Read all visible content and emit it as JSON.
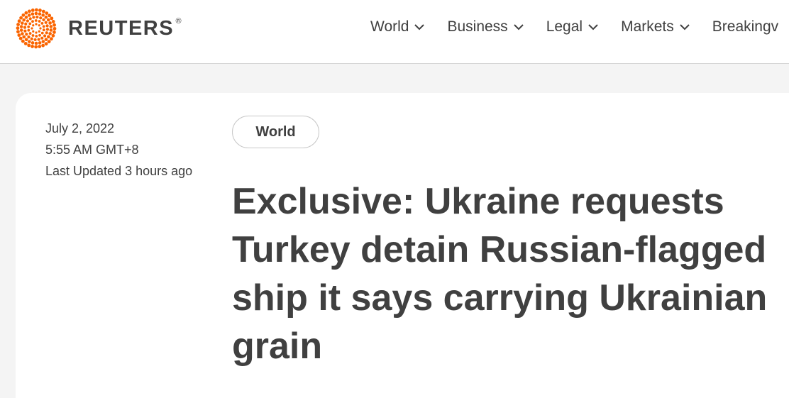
{
  "brand": {
    "name": "REUTERS",
    "registered": "®",
    "accent_color": "#fa6400"
  },
  "nav": {
    "items": [
      {
        "label": "World",
        "icon": "chevron-down-icon"
      },
      {
        "label": "Business",
        "icon": "chevron-down-icon"
      },
      {
        "label": "Legal",
        "icon": "chevron-down-icon"
      },
      {
        "label": "Markets",
        "icon": "chevron-down-icon"
      },
      {
        "label": "Breakingv",
        "icon": ""
      }
    ]
  },
  "article": {
    "date": "July 2, 2022",
    "time": "5:55 AM GMT+8",
    "updated": "Last Updated 3 hours ago",
    "section": "World",
    "headline": "Exclusive: Ukraine requests Turkey detain Russian-flagged ship it says carrying Ukrainian grain"
  }
}
